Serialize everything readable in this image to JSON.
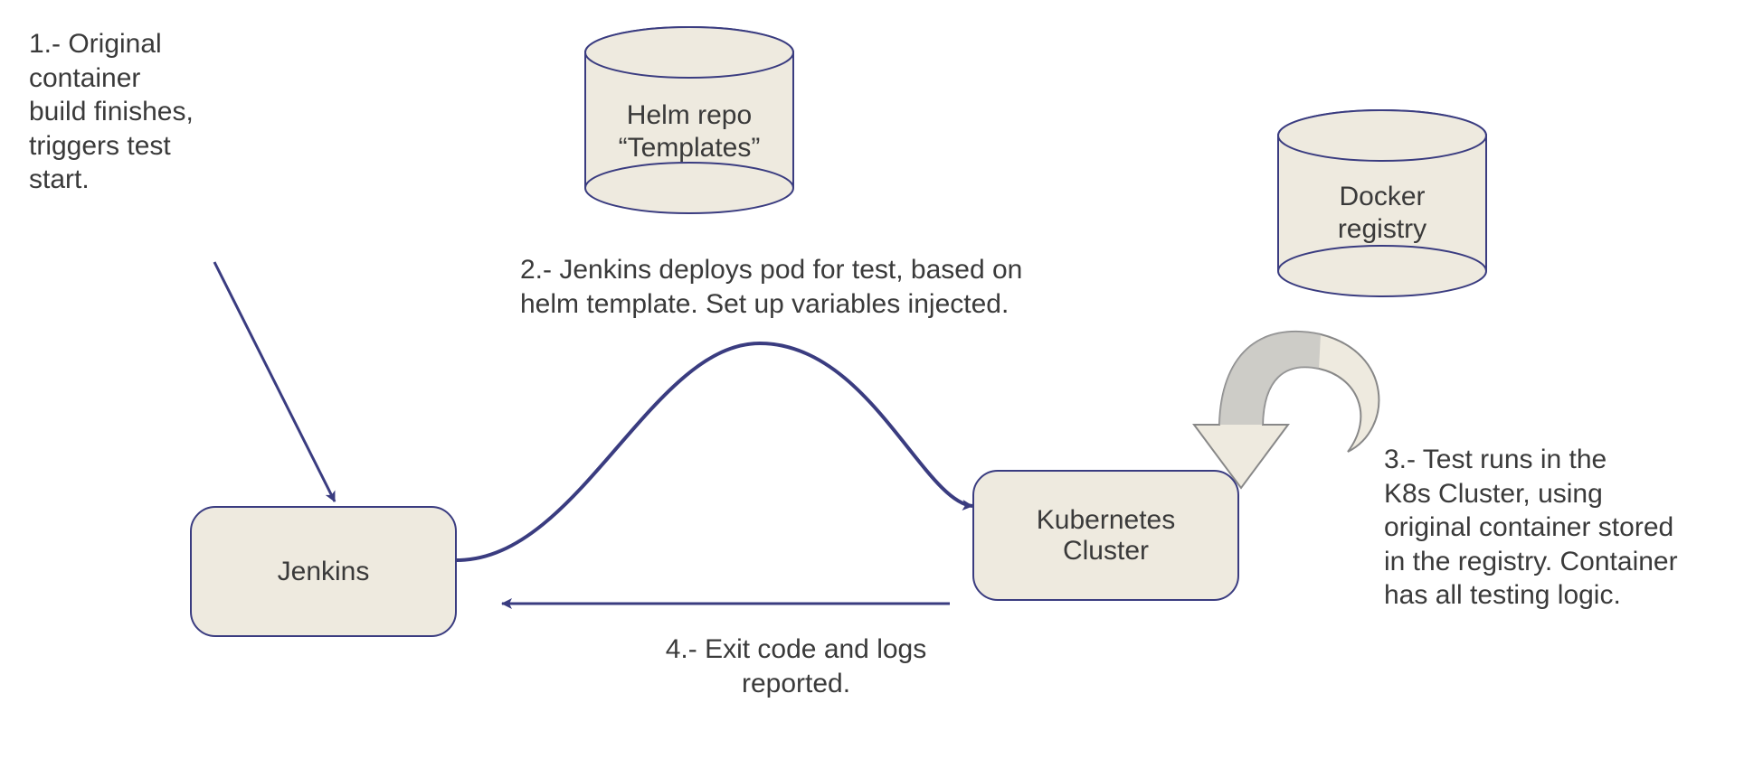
{
  "diagram": {
    "steps": {
      "step1": "1.- Original\ncontainer\nbuild finishes,\ntriggers test\nstart.",
      "step2": "2.- Jenkins deploys pod for test, based on\nhelm template. Set up variables injected.",
      "step3": "3.- Test runs in the\nK8s Cluster, using\noriginal container stored\nin the registry. Container\nhas all testing logic.",
      "step4": "4.- Exit code and logs\nreported."
    },
    "nodes": {
      "jenkins": "Jenkins",
      "kubernetes": "Kubernetes\nCluster",
      "helm_repo": "Helm repo\n“Templates”",
      "docker_registry": "Docker\nregistry"
    },
    "colors": {
      "node_fill": "#eeeadf",
      "node_border": "#3a3c80",
      "arrow": "#3a3c80",
      "curved_arrow_fill": "#b7b7b7",
      "text": "#3a3a3a"
    }
  }
}
